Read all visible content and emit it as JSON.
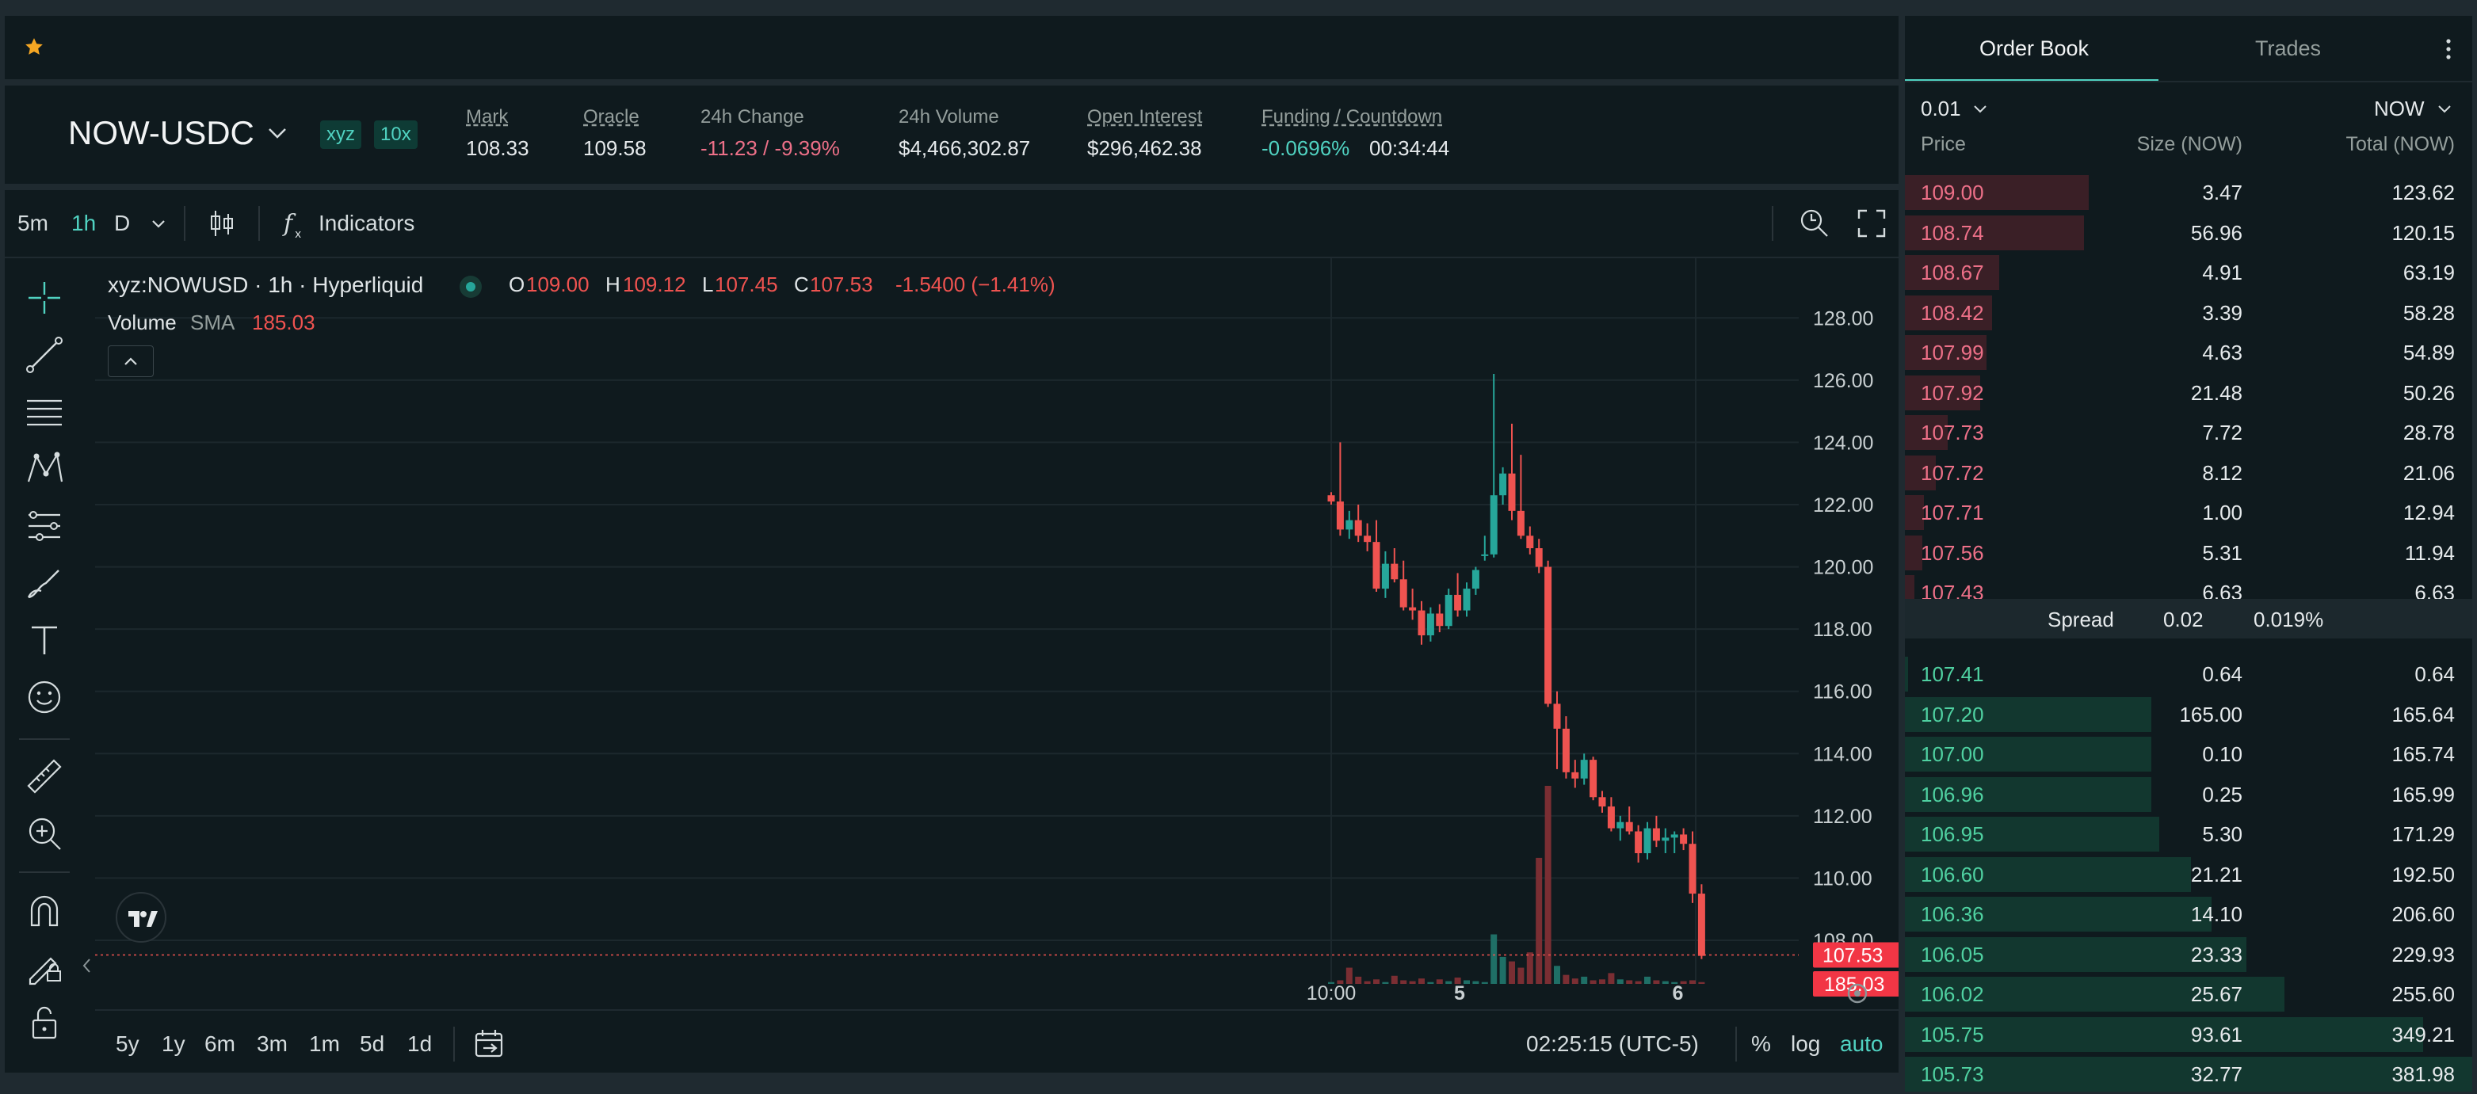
{
  "market": {
    "pair": "NOW-USDC",
    "badges": [
      "xyz",
      "10x"
    ],
    "stats": [
      {
        "label": "Mark",
        "value": "108.33"
      },
      {
        "label": "Oracle",
        "value": "109.58"
      },
      {
        "label": "24h Change",
        "value": "-11.23 / -9.39%"
      },
      {
        "label": "24h Volume",
        "value": "$4,466,302.87"
      },
      {
        "label": "Open Interest",
        "value": "$296,462.38"
      },
      {
        "label": "Funding / Countdown",
        "value": "-0.0696%",
        "value2": "00:34:44"
      }
    ]
  },
  "toolbar": {
    "intervals": [
      "5m",
      "1h",
      "D"
    ],
    "active_interval": "1h",
    "indicators_label": "Indicators"
  },
  "legend": {
    "symbol": "xyz:NOWUSD · 1h · Hyperliquid",
    "o_label": "O",
    "o": "109.00",
    "h_label": "H",
    "h": "109.12",
    "l_label": "L",
    "l": "107.45",
    "c_label": "C",
    "c": "107.53",
    "change": "-1.5400 (−1.41%)",
    "volume_label": "Volume",
    "sma_label": "SMA",
    "sma_value": "185.03"
  },
  "chart_data": {
    "type": "candlestick",
    "y_ticks": [
      "128.00",
      "126.00",
      "124.00",
      "122.00",
      "120.00",
      "118.00",
      "116.00",
      "114.00",
      "112.00",
      "110.00",
      "108.00"
    ],
    "ylim": [
      106.6,
      129.0
    ],
    "x_ticks": [
      "10:00",
      "5",
      "6"
    ],
    "last_price_label": "107.53",
    "last_price": 107.53,
    "volume_label": "185.03",
    "candles": [
      [
        122.3,
        122.4,
        122.0,
        122.1
      ],
      [
        122.1,
        124.0,
        121.0,
        121.2
      ],
      [
        121.2,
        121.8,
        120.9,
        121.5
      ],
      [
        121.5,
        122.0,
        120.8,
        121.0
      ],
      [
        121.0,
        121.4,
        120.5,
        120.8
      ],
      [
        120.8,
        121.5,
        119.2,
        119.3
      ],
      [
        119.3,
        120.5,
        119.0,
        120.1
      ],
      [
        120.1,
        120.6,
        119.5,
        119.6
      ],
      [
        119.6,
        120.2,
        118.6,
        118.7
      ],
      [
        118.7,
        119.3,
        118.3,
        118.6
      ],
      [
        118.6,
        118.9,
        117.5,
        117.8
      ],
      [
        117.8,
        118.7,
        117.6,
        118.5
      ],
      [
        118.5,
        118.8,
        117.9,
        118.1
      ],
      [
        118.1,
        119.3,
        118.0,
        119.1
      ],
      [
        119.1,
        119.8,
        118.4,
        118.6
      ],
      [
        118.6,
        119.5,
        118.4,
        119.3
      ],
      [
        119.3,
        120.0,
        119.1,
        119.9
      ],
      [
        120.4,
        121.0,
        120.2,
        120.4
      ],
      [
        120.4,
        126.2,
        120.3,
        122.3
      ],
      [
        122.3,
        123.2,
        122.0,
        123.0
      ],
      [
        123.0,
        124.6,
        121.5,
        121.8
      ],
      [
        121.8,
        123.6,
        120.9,
        121.0
      ],
      [
        121.0,
        121.3,
        120.4,
        120.6
      ],
      [
        120.6,
        120.9,
        119.8,
        120.0
      ],
      [
        120.0,
        120.2,
        115.5,
        115.6
      ],
      [
        115.6,
        116.0,
        113.5,
        114.8
      ],
      [
        114.8,
        115.2,
        113.2,
        113.4
      ],
      [
        113.4,
        113.8,
        112.9,
        113.2
      ],
      [
        113.2,
        114.0,
        113.0,
        113.8
      ],
      [
        113.8,
        113.9,
        112.5,
        112.6
      ],
      [
        112.6,
        112.8,
        112.1,
        112.3
      ],
      [
        112.3,
        112.6,
        111.5,
        111.6
      ],
      [
        111.6,
        112.0,
        111.2,
        111.8
      ],
      [
        111.8,
        112.3,
        111.4,
        111.5
      ],
      [
        111.5,
        111.7,
        110.5,
        110.8
      ],
      [
        110.8,
        111.8,
        110.6,
        111.6
      ],
      [
        111.6,
        112.0,
        111.0,
        111.2
      ],
      [
        111.2,
        111.6,
        110.8,
        111.3
      ],
      [
        111.3,
        111.5,
        110.8,
        111.4
      ],
      [
        111.4,
        111.6,
        110.9,
        111.1
      ],
      [
        111.1,
        111.5,
        109.2,
        109.5
      ],
      [
        109.5,
        109.8,
        107.4,
        107.5
      ]
    ],
    "volumes": [
      2,
      4,
      18,
      8,
      3,
      5,
      2,
      9,
      4,
      3,
      6,
      2,
      5,
      3,
      7,
      4,
      3,
      2,
      55,
      30,
      25,
      18,
      35,
      140,
      220,
      20,
      10,
      6,
      8,
      4,
      5,
      12,
      5,
      4,
      3,
      8,
      4,
      3,
      2,
      3,
      4,
      2
    ],
    "volume_colors": [
      "green",
      "red",
      "red",
      "red",
      "red",
      "red",
      "green",
      "red",
      "red",
      "red",
      "red",
      "green",
      "red",
      "green",
      "red",
      "green",
      "green",
      "green",
      "green",
      "green",
      "red",
      "red",
      "red",
      "red",
      "red",
      "green",
      "red",
      "red",
      "green",
      "red",
      "red",
      "red",
      "green",
      "red",
      "red",
      "green",
      "red",
      "green",
      "green",
      "red",
      "red",
      "red"
    ],
    "colors": {
      "up": "#26a69a",
      "down": "#ef5350"
    }
  },
  "time_ranges": [
    "5y",
    "1y",
    "6m",
    "3m",
    "1m",
    "5d",
    "1d"
  ],
  "footer": {
    "time": "02:25:15 (UTC-5)",
    "percent": "%",
    "log": "log",
    "auto": "auto"
  },
  "orderbook": {
    "tabs": [
      "Order Book",
      "Trades"
    ],
    "tick_size": "0.01",
    "unit": "NOW",
    "headers": {
      "price": "Price",
      "size": "Size (NOW)",
      "total": "Total (NOW)"
    },
    "asks": [
      {
        "price": "109.00",
        "size": "3.47",
        "total": "123.62",
        "depth": 0.324
      },
      {
        "price": "108.74",
        "size": "56.96",
        "total": "120.15",
        "depth": 0.315
      },
      {
        "price": "108.67",
        "size": "4.91",
        "total": "63.19",
        "depth": 0.166
      },
      {
        "price": "108.42",
        "size": "3.39",
        "total": "58.28",
        "depth": 0.153
      },
      {
        "price": "107.99",
        "size": "4.63",
        "total": "54.89",
        "depth": 0.144
      },
      {
        "price": "107.92",
        "size": "21.48",
        "total": "50.26",
        "depth": 0.132
      },
      {
        "price": "107.73",
        "size": "7.72",
        "total": "28.78",
        "depth": 0.075
      },
      {
        "price": "107.72",
        "size": "8.12",
        "total": "21.06",
        "depth": 0.055
      },
      {
        "price": "107.71",
        "size": "1.00",
        "total": "12.94",
        "depth": 0.034
      },
      {
        "price": "107.56",
        "size": "5.31",
        "total": "11.94",
        "depth": 0.031
      },
      {
        "price": "107.43",
        "size": "6.63",
        "total": "6.63",
        "depth": 0.017
      }
    ],
    "spread": {
      "label": "Spread",
      "value": "0.02",
      "percent": "0.019%"
    },
    "bids": [
      {
        "price": "107.41",
        "size": "0.64",
        "total": "0.64",
        "depth": 0.002
      },
      {
        "price": "107.20",
        "size": "165.00",
        "total": "165.64",
        "depth": 0.434
      },
      {
        "price": "107.00",
        "size": "0.10",
        "total": "165.74",
        "depth": 0.434
      },
      {
        "price": "106.96",
        "size": "0.25",
        "total": "165.99",
        "depth": 0.435
      },
      {
        "price": "106.95",
        "size": "5.30",
        "total": "171.29",
        "depth": 0.449
      },
      {
        "price": "106.60",
        "size": "21.21",
        "total": "192.50",
        "depth": 0.504
      },
      {
        "price": "106.36",
        "size": "14.10",
        "total": "206.60",
        "depth": 0.541
      },
      {
        "price": "106.05",
        "size": "23.33",
        "total": "229.93",
        "depth": 0.602
      },
      {
        "price": "106.02",
        "size": "25.67",
        "total": "255.60",
        "depth": 0.669
      },
      {
        "price": "105.75",
        "size": "93.61",
        "total": "349.21",
        "depth": 0.914
      },
      {
        "price": "105.73",
        "size": "32.77",
        "total": "381.98",
        "depth": 1.0
      }
    ]
  }
}
